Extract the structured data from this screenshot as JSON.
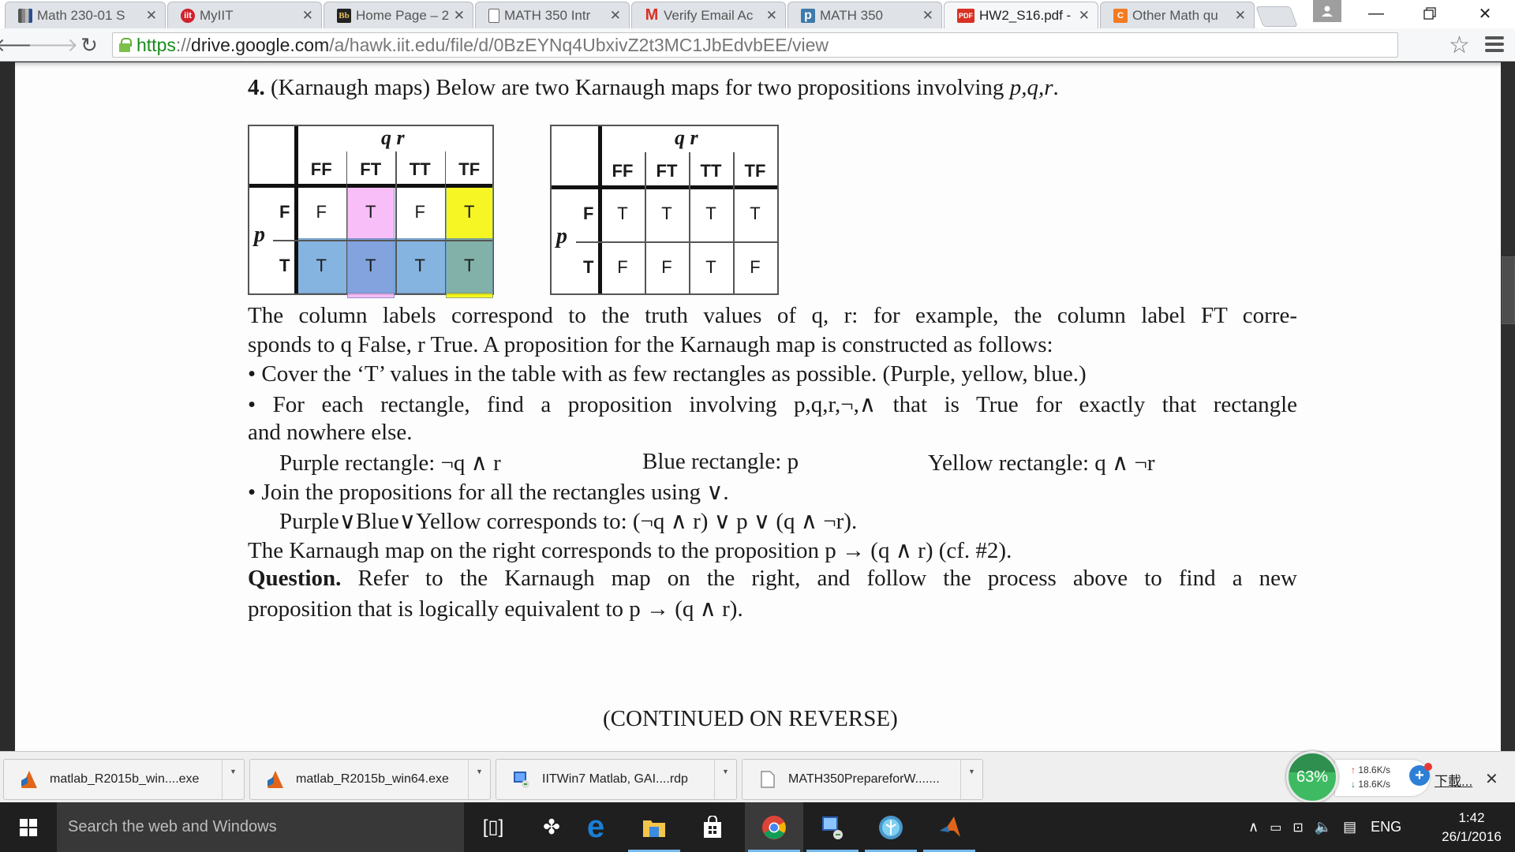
{
  "browser": {
    "tabs": [
      {
        "title": "Math 230-01 S",
        "icon": "bars-icon",
        "active": false
      },
      {
        "title": "MyIIT",
        "icon": "iit-icon",
        "active": false
      },
      {
        "title": "Home Page – 2",
        "icon": "blackboard-icon",
        "active": false
      },
      {
        "title": "MATH 350 Intr",
        "icon": "document-icon",
        "active": false
      },
      {
        "title": "Verify Email Ac",
        "icon": "gmail-icon",
        "active": false
      },
      {
        "title": "MATH 350",
        "icon": "piazza-icon",
        "active": false
      },
      {
        "title": "HW2_S16.pdf -",
        "icon": "pdf-icon",
        "active": true
      },
      {
        "title": "Other Math qu",
        "icon": "chegg-icon",
        "active": false
      }
    ],
    "tab_icon_labels": {
      "pdf": "PDF",
      "blackboard": "Bb",
      "chegg": "C",
      "piazza": "p",
      "gmail": "M",
      "iit": "iit"
    },
    "url": {
      "scheme": "https",
      "separator": "://",
      "host": "drive.google.com",
      "path": "/a/hawk.iit.edu/file/d/0BzEYNq4UbxivZ2t3MC1JbEdvbEE/view"
    }
  },
  "document": {
    "heading_number": "4.",
    "heading_text": "(Karnaugh maps) Below are two Karnaugh maps for two propositions involving ",
    "heading_vars": "p,q,r",
    "heading_end": ".",
    "kmaps": [
      {
        "col_var": "q r",
        "row_var": "p",
        "columns": [
          "FF",
          "FT",
          "TT",
          "TF"
        ],
        "rows": [
          "F",
          "T"
        ],
        "cells": [
          [
            "F",
            "T",
            "F",
            "T"
          ],
          [
            "T",
            "T",
            "T",
            "T"
          ]
        ],
        "highlights": [
          {
            "name": "purple",
            "color": "#f7b3f7",
            "rows": [
              0,
              1
            ],
            "cols": [
              1,
              1
            ]
          },
          {
            "name": "yellow",
            "color": "#f5f500",
            "rows": [
              0,
              1
            ],
            "cols": [
              3,
              3
            ]
          },
          {
            "name": "blue",
            "color": "#5b9bd5",
            "rows": [
              1,
              1
            ],
            "cols": [
              0,
              3
            ]
          }
        ]
      },
      {
        "col_var": "q r",
        "row_var": "p",
        "columns": [
          "FF",
          "FT",
          "TT",
          "TF"
        ],
        "rows": [
          "F",
          "T"
        ],
        "cells": [
          [
            "T",
            "T",
            "T",
            "T"
          ],
          [
            "F",
            "F",
            "T",
            "F"
          ]
        ],
        "highlights": []
      }
    ],
    "para1_line1": "The column labels correspond to the truth values of q, r: for example, the column label FT corre-",
    "para1_line2": "sponds to q False, r True. A proposition for the Karnaugh map is constructed as follows:",
    "bullet1": "• Cover the ‘T’ values in the table with as few rectangles as possible. (Purple, yellow, blue.)",
    "bullet2_line1": "• For each rectangle, find a proposition involving p,q,r,¬,∧ that is True for exactly that rectangle",
    "bullet2_line2": "and nowhere else.",
    "rect_purple": "Purple rectangle: ¬q ∧ r",
    "rect_blue": "Blue rectangle: p",
    "rect_yellow": "Yellow rectangle: q ∧ ¬r",
    "bullet3": "• Join the propositions for all the rectangles using ∨.",
    "join_line": "Purple∨Blue∨Yellow corresponds to: (¬q ∧ r) ∨ p ∨ (q ∧ ¬r).",
    "right_map_line": "The Karnaugh map on the right corresponds to the proposition p → (q ∧ r) (cf. #2).",
    "question_label": "Question.",
    "question_line1": " Refer to the Karnaugh map on the right, and follow the process above to find a new",
    "question_line2": "proposition that is logically equivalent to p → (q ∧ r).",
    "continued": "(CONTINUED ON REVERSE)"
  },
  "downloads": [
    {
      "name": "matlab_R2015b_win....exe",
      "icon": "matlab-icon"
    },
    {
      "name": "matlab_R2015b_win64.exe",
      "icon": "matlab-icon"
    },
    {
      "name": "IITWin7 Matlab, GAI....rdp",
      "icon": "remote-desktop-icon"
    },
    {
      "name": "MATH350PrepareforW.......",
      "icon": "file-icon"
    }
  ],
  "net_widget": {
    "percent": "63%",
    "upload": "18.6K/s",
    "download": "18.6K/s"
  },
  "shelf": {
    "show_all": "下載..."
  },
  "taskbar": {
    "search_placeholder": "Search the web and Windows",
    "language": "ENG",
    "time": "1:42",
    "date": "26/1/2016"
  }
}
